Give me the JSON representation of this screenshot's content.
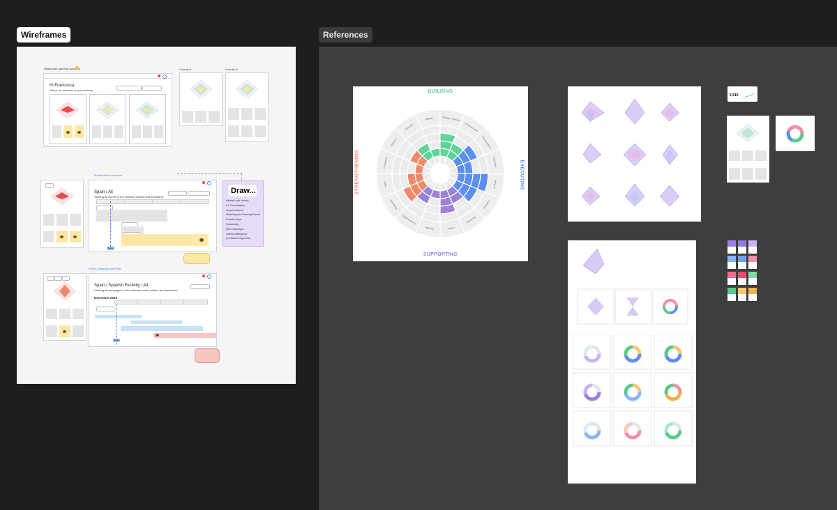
{
  "frames": {
    "wireframes_label": "Wireframes",
    "references_label": "References"
  },
  "wireframes": {
    "dashboard_label": "Dashboard, general overview",
    "greeting": "Hi Francesca,",
    "greeting_sub": "Here's an overview of your territory",
    "country_a_label": "Country A",
    "country_b_label": "Country B",
    "market_overview_label": "Market event overview",
    "market_title": "Spain / All",
    "market_sub": "Viewing all events in the selected market and timeframe.",
    "draw_card": {
      "title": "Draw...",
      "items": [
        "Athlete/Local Heroes",
        "CX Consolidation",
        "Target Audience",
        "Marketing and Sourcing Events",
        "Portfolio Gaps",
        "Seasonality",
        "Plan Campaigns",
        "Internal Intelligence",
        "(Consumer segments)"
      ]
    },
    "event_overview_label": "Event_campaign overview",
    "event_title": "Spain / Spanish Festivity / All",
    "event_sub": "Viewing all campaigns in the selected event, market, and timeframe.",
    "event_month": "December 2023",
    "tab_label": "Spain",
    "today_badge": "Today"
  },
  "references": {
    "wheel": {
      "top": "BUILDING",
      "right": "EXECUTING",
      "bottom": "SUPPORTING",
      "left": "STRENGTHENING",
      "colors": {
        "building": "#5ed39b",
        "executing": "#5b8ff0",
        "supporting": "#9a82db",
        "strengthening": "#f08a6c"
      },
      "segments": [
        "Execution",
        "Ideation",
        "Strategic Thinking",
        "Communication",
        "Self-Assurance",
        "Maximizer",
        "Achiever",
        "Analytical",
        "Big Design",
        "Culture",
        "Empathy",
        "Connectedness",
        "Restorative",
        "Belief",
        "Consistency",
        "Harmony"
      ]
    },
    "stat_card_value": "2,410",
    "palette": [
      "#9b7fe6",
      "#8f7be3",
      "#c7b4f2",
      "#89b6f5",
      "#6e9ff0",
      "#f18fa5",
      "#ef6d8d",
      "#e74b6f",
      "#7fdba6",
      "#5ac98c",
      "#f6c774",
      "#f1b04f"
    ]
  }
}
